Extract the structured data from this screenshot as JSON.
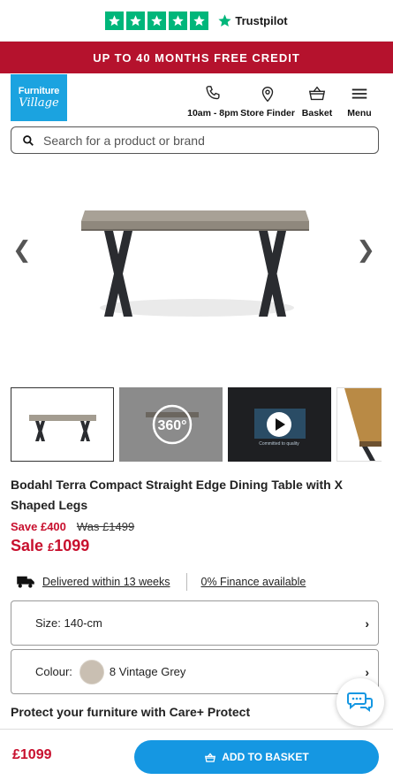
{
  "trustpilot": {
    "brand": "Trustpilot",
    "rating_stars": 5
  },
  "promo": {
    "text": "UP TO 40 MONTHS FREE CREDIT"
  },
  "logo": {
    "line1": "Furniture",
    "line2": "Village"
  },
  "nav": {
    "hours": "10am - 8pm",
    "store_finder": "Store Finder",
    "basket": "Basket",
    "menu": "Menu"
  },
  "search": {
    "placeholder": "Search for a product or brand"
  },
  "gallery": {
    "thumb_360_label": "360°",
    "video_caption": "Committed to quality"
  },
  "product": {
    "title": "Bodahl Terra Compact Straight Edge Dining Table with X Shaped Legs",
    "save": "Save £400",
    "was": "Was £1499",
    "sale_label": "Sale ",
    "sale_currency": "£",
    "sale_amount": "1099"
  },
  "delivery": {
    "text": "Delivered within 13 weeks",
    "finance": "0% Finance available"
  },
  "options": {
    "size_label": "Size:",
    "size_value": "140-cm",
    "colour_label": "Colour:",
    "colour_value": "8 Vintage Grey",
    "colour_hex": "#c9bfb2"
  },
  "protect": {
    "heading": "Protect your furniture with Care+ Protect"
  },
  "sticky": {
    "price": "£1099",
    "add_button": "ADD TO BASKET"
  },
  "colors": {
    "brand_blue": "#1ba3e0",
    "promo_red": "#b5122d",
    "sale_red": "#c8102e",
    "trustpilot_green": "#00b67a",
    "cta_blue": "#1597e2"
  }
}
